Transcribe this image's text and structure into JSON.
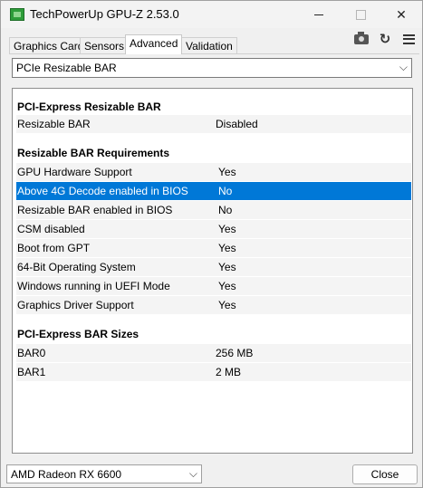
{
  "window": {
    "title": "TechPowerUp GPU-Z 2.53.0",
    "controls": {
      "minimize": "",
      "maximize": "",
      "close": "✕"
    }
  },
  "tabs": [
    {
      "label": "Graphics Card",
      "active": false
    },
    {
      "label": "Sensors",
      "active": false
    },
    {
      "label": "Advanced",
      "active": true
    },
    {
      "label": "Validation",
      "active": false
    }
  ],
  "toolbar": {
    "icons": [
      "camera-icon",
      "refresh-icon",
      "menu-icon"
    ],
    "refresh_glyph": "↻"
  },
  "section_dropdown": {
    "selected": "PCIe Resizable BAR",
    "chevron": "⌵"
  },
  "sections": [
    {
      "title": "PCI-Express Resizable BAR",
      "rows": [
        {
          "label": "Resizable BAR",
          "value": "Disabled"
        }
      ]
    },
    {
      "title": "Resizable BAR Requirements",
      "rows": [
        {
          "label": "GPU Hardware Support",
          "value": "Yes"
        },
        {
          "label": "Above 4G Decode enabled in BIOS",
          "value": "No",
          "selected": true
        },
        {
          "label": "Resizable BAR enabled in BIOS",
          "value": "No"
        },
        {
          "label": "CSM disabled",
          "value": "Yes"
        },
        {
          "label": "Boot from GPT",
          "value": "Yes"
        },
        {
          "label": "64-Bit Operating System",
          "value": "Yes"
        },
        {
          "label": "Windows running in UEFI Mode",
          "value": "Yes"
        },
        {
          "label": "Graphics Driver Support",
          "value": "Yes"
        }
      ]
    },
    {
      "title": "PCI-Express BAR Sizes",
      "rows": [
        {
          "label": "BAR0",
          "value": "256 MB"
        },
        {
          "label": "BAR1",
          "value": "2 MB"
        }
      ]
    }
  ],
  "gpu_select": {
    "selected": "AMD Radeon RX 6600",
    "chevron": "⌵"
  },
  "close_button": {
    "label": "Close"
  },
  "colors": {
    "selection": "#0078d7",
    "row_bg": "#f4f4f4"
  }
}
